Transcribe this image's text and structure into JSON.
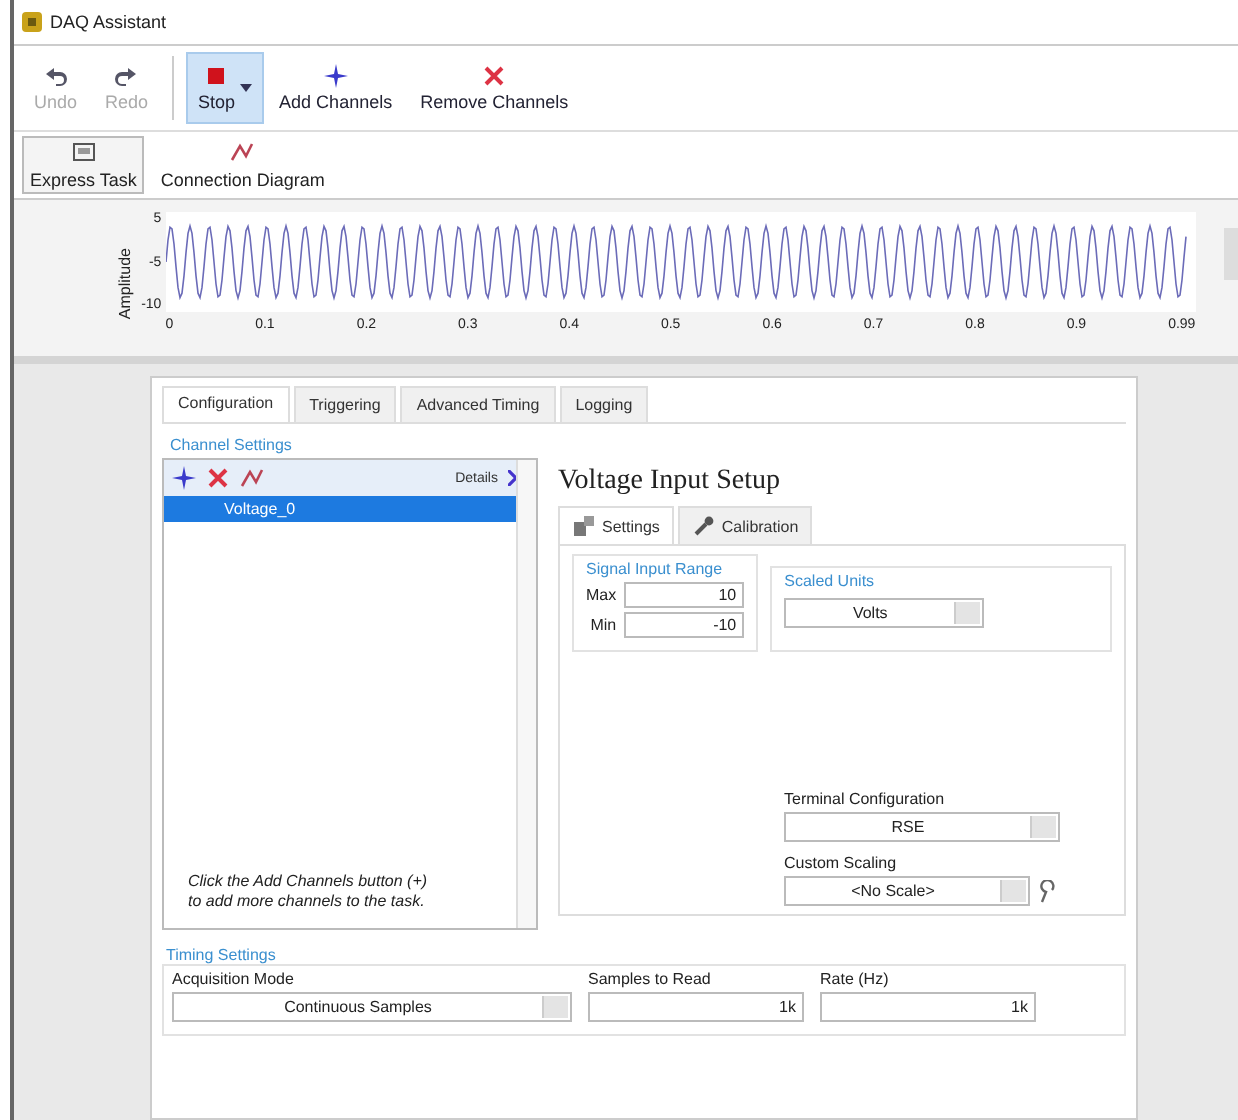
{
  "window": {
    "title": "DAQ Assistant"
  },
  "toolbar": [
    {
      "label": "Undo",
      "kind": "undo",
      "disabled": true,
      "highlighted": false
    },
    {
      "label": "Redo",
      "kind": "redo",
      "disabled": true,
      "highlighted": false
    },
    {
      "label": "Stop",
      "kind": "stop",
      "disabled": false,
      "highlighted": true
    },
    {
      "label": "Add Channels",
      "kind": "add",
      "disabled": false,
      "highlighted": false
    },
    {
      "label": "Remove Channels",
      "kind": "remove",
      "disabled": false,
      "highlighted": false
    }
  ],
  "view_tabs": [
    {
      "label": "Express Task",
      "kind": "task",
      "selected": true
    },
    {
      "label": "Connection Diagram",
      "kind": "diagram",
      "selected": false
    }
  ],
  "plot": {
    "ylabel": "Amplitude",
    "yticks": [
      "5",
      "-5",
      "-10"
    ],
    "xticks": [
      "0",
      "0.1",
      "0.2",
      "0.3",
      "0.4",
      "0.5",
      "0.6",
      "0.7",
      "0.8",
      "0.9",
      "0.99"
    ]
  },
  "config_tabs": [
    {
      "label": "Configuration",
      "selected": true
    },
    {
      "label": "Triggering",
      "selected": false
    },
    {
      "label": "Advanced Timing",
      "selected": false
    },
    {
      "label": "Logging",
      "selected": false
    }
  ],
  "channel_settings": {
    "title": "Channel Settings",
    "details_label": "Details",
    "channels": [
      {
        "name": "Voltage_0",
        "selected": true
      }
    ],
    "hint": "Click the Add Channels button (+) to add more channels to the task."
  },
  "setup": {
    "title": "Voltage Input Setup",
    "tabs": [
      {
        "label": "Settings",
        "kind": "settings",
        "selected": true
      },
      {
        "label": "Calibration",
        "kind": "calibration",
        "selected": false
      }
    ],
    "range": {
      "title": "Signal Input Range",
      "max_label": "Max",
      "max": "10",
      "min_label": "Min",
      "min": "-10"
    },
    "scaled_units": {
      "title": "Scaled Units",
      "value": "Volts"
    },
    "terminal": {
      "label": "Terminal Configuration",
      "value": "RSE"
    },
    "scaling": {
      "label": "Custom Scaling",
      "value": "<No Scale>"
    }
  },
  "timing": {
    "title": "Timing Settings",
    "mode_label": "Acquisition Mode",
    "mode": "Continuous Samples",
    "samples_label": "Samples to Read",
    "samples": "1k",
    "rate_label": "Rate (Hz)",
    "rate": "1k"
  }
}
